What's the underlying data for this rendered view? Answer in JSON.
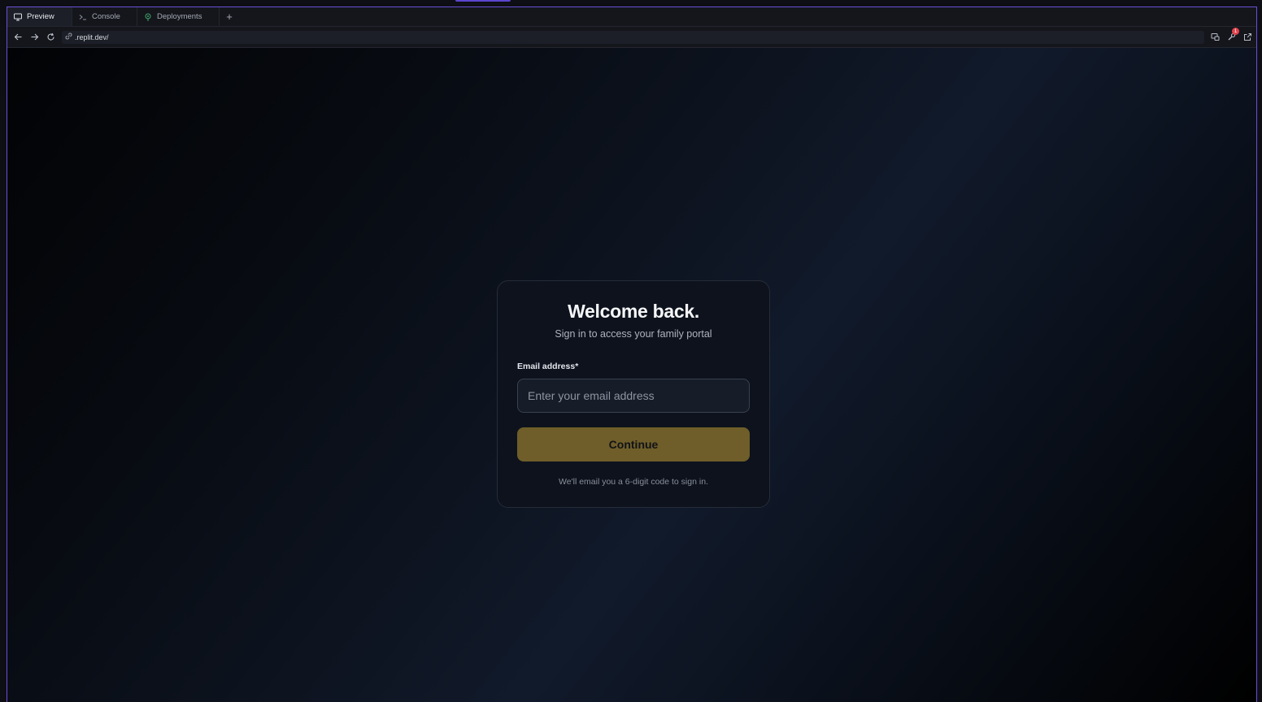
{
  "tabs": {
    "preview": "Preview",
    "console": "Console",
    "deployments": "Deployments",
    "add": "+"
  },
  "address_bar": {
    "url": ".replit.dev/",
    "notification_count": "1"
  },
  "login_card": {
    "title": "Welcome back.",
    "subtitle": "Sign in to access your family portal",
    "email_label": "Email address*",
    "email_placeholder": "Enter your email address",
    "email_value": "",
    "continue_label": "Continue",
    "hint": "We'll email you a 6-digit code to sign in."
  },
  "colors": {
    "frame_accent": "#6b4fd8",
    "button_gold": "#6f5e2a",
    "badge_red": "#e2414b"
  },
  "icons": [
    "monitor-icon",
    "terminal-icon",
    "deploy-icon",
    "plus-icon",
    "arrow-left-icon",
    "arrow-right-icon",
    "refresh-icon",
    "link-icon",
    "devtools-icon",
    "wrench-icon",
    "external-link-icon"
  ]
}
